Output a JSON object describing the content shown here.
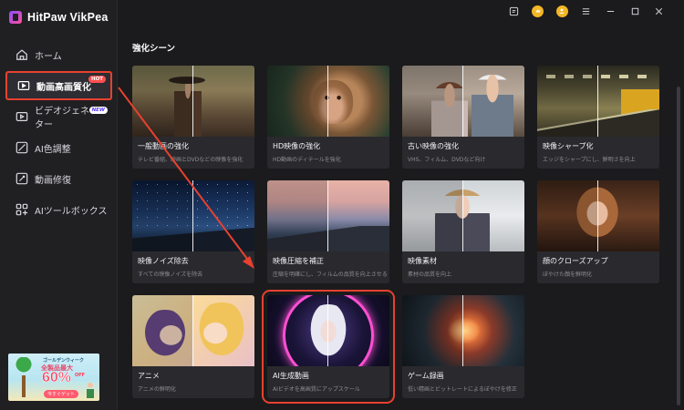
{
  "app": {
    "title": "HitPaw VikPea"
  },
  "sidebar": {
    "items": [
      {
        "label": "ホーム",
        "icon": "home-icon",
        "active": false,
        "badge": ""
      },
      {
        "label": "動画高画質化",
        "icon": "video-enhance-icon",
        "active": true,
        "badge": "HOT"
      },
      {
        "label": "ビデオジェネレーター",
        "icon": "video-generator-icon",
        "active": false,
        "badge": "NEW"
      },
      {
        "label": "AI色調整",
        "icon": "color-adjust-icon",
        "active": false,
        "badge": ""
      },
      {
        "label": "動画修復",
        "icon": "video-repair-icon",
        "active": false,
        "badge": ""
      },
      {
        "label": "AIツールボックス",
        "icon": "toolbox-icon",
        "active": false,
        "badge": ""
      }
    ]
  },
  "promo": {
    "top": "ゴールデンウィーク",
    "mid": "全製品最大",
    "percent": "60%",
    "off": "OFF",
    "button": "今すぐゲット"
  },
  "topbar": {
    "icons": [
      "feedback-icon",
      "coin-icon",
      "account-icon",
      "menu-icon",
      "minimize-icon",
      "maximize-icon",
      "close-icon"
    ]
  },
  "main": {
    "section_title": "強化シーン",
    "cards": [
      {
        "title": "一般動画の強化",
        "desc": "テレビ番組、映画とDVDなどの映像を強化"
      },
      {
        "title": "HD映像の強化",
        "desc": "HD動画のディテールを強化"
      },
      {
        "title": "古い映像の強化",
        "desc": "VHS、フィルム、DVDなど向け"
      },
      {
        "title": "映像シャープ化",
        "desc": "エッジをシャープにし、鮮明さを向上"
      },
      {
        "title": "映像ノイズ除去",
        "desc": "すべての映像ノイズを除去"
      },
      {
        "title": "映像圧縮を補正",
        "desc": "圧縮を明確にし、フィルムの品質を向上させる"
      },
      {
        "title": "映像素材",
        "desc": "素材の品質を向上"
      },
      {
        "title": "顔のクローズアップ",
        "desc": "ぼやけた顔を鮮明化"
      },
      {
        "title": "アニメ",
        "desc": "アニメの鮮明化"
      },
      {
        "title": "AI生成動画",
        "desc": "AIビデオを高画質にアップスケール"
      },
      {
        "title": "ゲーム録画",
        "desc": "低い精画とビットレートによるぼやけを修正"
      }
    ]
  },
  "colors": {
    "accent": "#e8412f",
    "background": "#1b1b1d",
    "sidebar": "#202023",
    "card": "#2a2a2e"
  }
}
